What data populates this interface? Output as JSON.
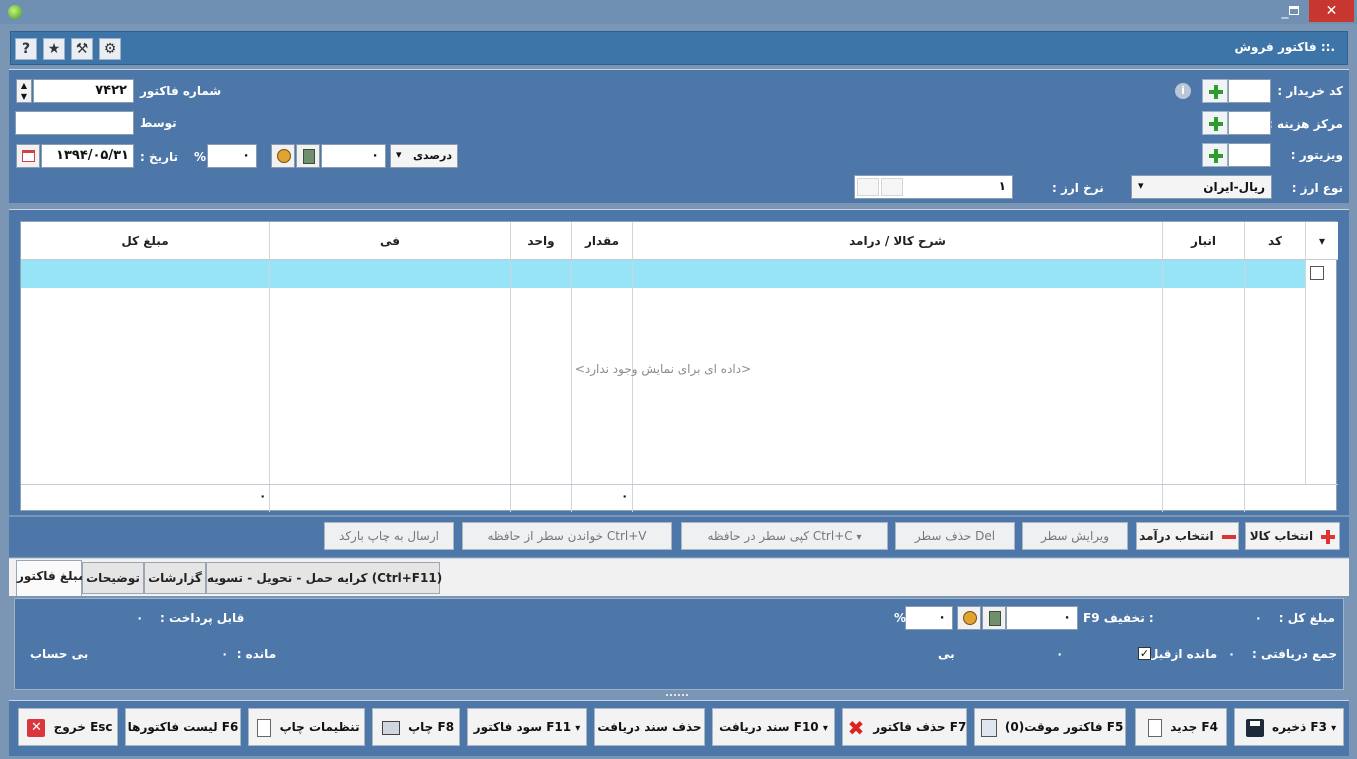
{
  "window": {
    "title": "فاکتور فروش",
    "title_prefix": ".::",
    "buttons": {
      "minimize": "_",
      "close": "✕"
    }
  },
  "header": {
    "title": "فاکتور فروش",
    "icons": [
      "gear-icon",
      "tools-icon",
      "star-icon",
      "help-icon"
    ],
    "help_glyph": "?",
    "star_glyph": "★",
    "tools_glyph": "⚒",
    "gear_glyph": "⚙"
  },
  "form": {
    "buyer_code_label": "کد خریدار :",
    "cost_center_label": "مرکز هزینه :",
    "visitor_label": "ویزیتور :",
    "currency_type_label": "نوع ارز :",
    "currency_type_value": "ریال-ایران",
    "exchange_rate_label": "نرخ ارز :",
    "exchange_rate_value": "۱",
    "invoice_number_label": "شماره فاکتور",
    "invoice_number_value": "۷۴۲۲",
    "by_label": "توسط",
    "date_label": "تاریخ :",
    "date_value": "۱۳۹۴/۰۵/۳۱",
    "percent_symbol": "%",
    "percent_value": "۰",
    "amount_value": "۰",
    "mode_value": "درصدی",
    "info_glyph": "i"
  },
  "grid": {
    "columns": [
      "کد",
      "انبار",
      "شرح کالا / درامد",
      "مقدار",
      "واحد",
      "فی",
      "مبلغ کل"
    ],
    "empty_message": "<داده ای برای نمایش وجود ندارد>",
    "footer": {
      "quantity_total": "۰",
      "amount_total": "۰"
    },
    "filter_glyph": "▾"
  },
  "actions": {
    "select_product": "انتخاب کالا",
    "select_income": "انتخاب درآمد",
    "edit_row": "ویرایش سطر",
    "delete_row": "حذف سطر  Del",
    "copy_row": "کپی سطر در حافظه Ctrl+C",
    "paste_row": "خواندن سطر از حافظه Ctrl+V",
    "send_barcode": "ارسال به چاپ بارکد"
  },
  "tabs": [
    "مبلغ فاکتور",
    "توضیحات",
    "گزارشات",
    "کرایه حمل - تحویل - تسویه (Ctrl+F11)"
  ],
  "totals": {
    "total_label": "مبلغ کل :",
    "total_value": "۰",
    "discount_label": "F9 تخفیف :",
    "discount_value": "۰",
    "discount_percent_value": "۰",
    "percent_symbol": "%",
    "payable_label": "قابل پرداخت :",
    "payable_value": "۰",
    "received_label": "جمع دریافتی :",
    "received_value": "۰",
    "prev_balance_label": "مانده ازقبل",
    "prev_balance_value": "۰",
    "status_value": "بی",
    "remaining_label": "مانده :",
    "remaining_value": "۰",
    "account_status": "بی حساب"
  },
  "toolbar": {
    "save": "ذخیره F3",
    "new": "جدید F4",
    "temp_invoice": "فاکتور موقت(0) F5",
    "delete_invoice": "حذف فاکتور F7",
    "receipt_doc": "سند دریافت F10",
    "delete_receipt": "حذف سند دریافت",
    "invoice_profit": "سود فاکتور F11",
    "print": "چاپ F8",
    "print_settings": "تنظیمات چاپ",
    "invoice_list": "لیست فاکتورها F6",
    "exit": "خروج Esc"
  },
  "colors": {
    "panel": "#4d77a8",
    "header": "#3e75a8",
    "selected_row": "#97e4f7",
    "close_button": "#c8372f"
  }
}
